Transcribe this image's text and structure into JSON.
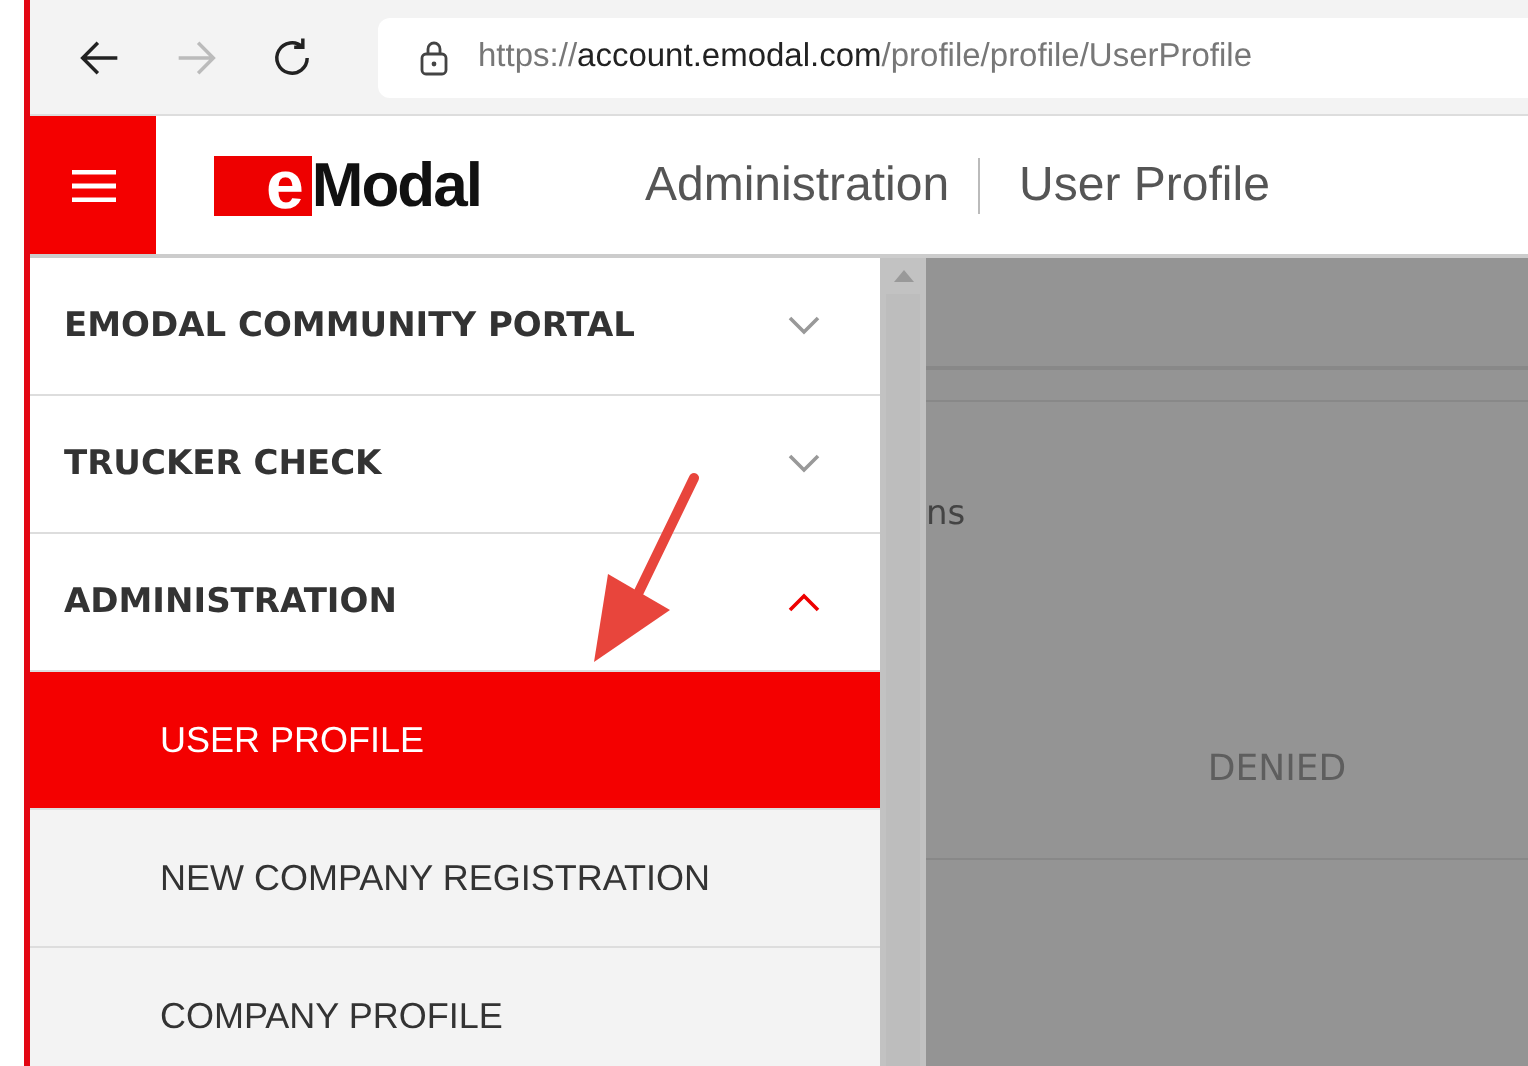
{
  "browser": {
    "url_scheme": "https://",
    "url_host": "account.emodal.com",
    "url_path": "/profile/profile/UserProfile"
  },
  "header": {
    "logo_mark": "e",
    "logo_text": "Modal",
    "section": "Administration",
    "page": "User Profile"
  },
  "sidebar": {
    "sections": [
      {
        "label": "EMODAL COMMUNITY PORTAL",
        "expanded": false
      },
      {
        "label": "TRUCKER CHECK",
        "expanded": false
      },
      {
        "label": "ADMINISTRATION",
        "expanded": true,
        "children": [
          {
            "label": "USER PROFILE",
            "selected": true
          },
          {
            "label": "NEW COMPANY REGISTRATION",
            "selected": false
          },
          {
            "label": "COMPANY PROFILE",
            "selected": false
          }
        ]
      }
    ]
  },
  "background": {
    "partial_text": "ns",
    "status_label": "DENIED"
  }
}
